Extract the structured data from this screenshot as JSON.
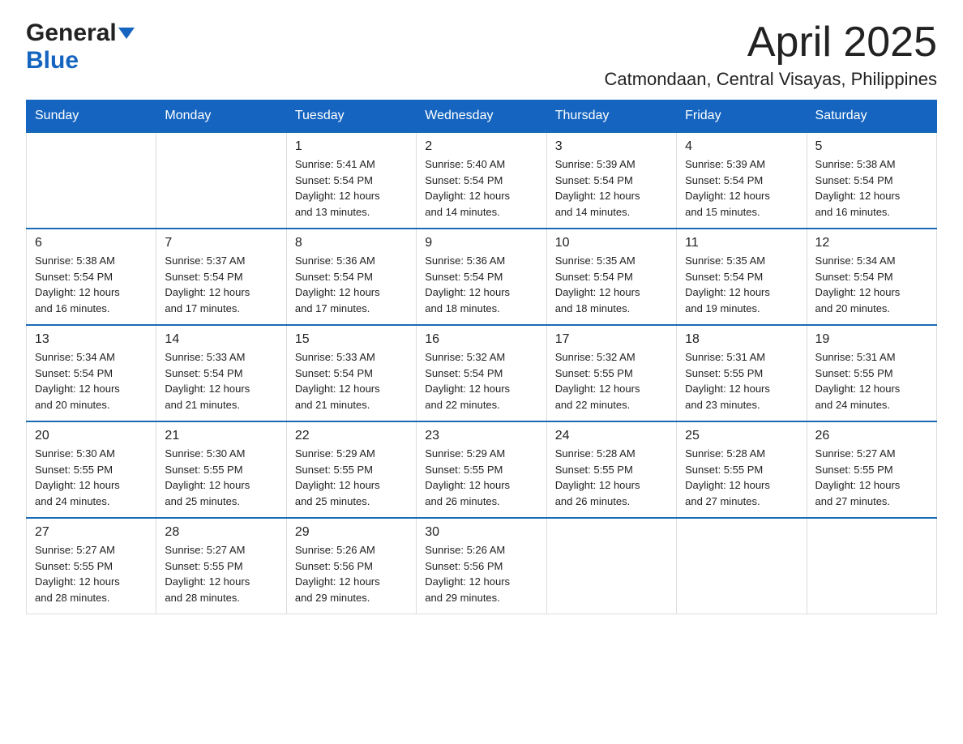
{
  "header": {
    "logo_general": "General",
    "logo_blue": "Blue",
    "title": "April 2025",
    "subtitle": "Catmondaan, Central Visayas, Philippines"
  },
  "weekdays": [
    "Sunday",
    "Monday",
    "Tuesday",
    "Wednesday",
    "Thursday",
    "Friday",
    "Saturday"
  ],
  "weeks": [
    [
      {
        "day": "",
        "info": ""
      },
      {
        "day": "",
        "info": ""
      },
      {
        "day": "1",
        "info": "Sunrise: 5:41 AM\nSunset: 5:54 PM\nDaylight: 12 hours\nand 13 minutes."
      },
      {
        "day": "2",
        "info": "Sunrise: 5:40 AM\nSunset: 5:54 PM\nDaylight: 12 hours\nand 14 minutes."
      },
      {
        "day": "3",
        "info": "Sunrise: 5:39 AM\nSunset: 5:54 PM\nDaylight: 12 hours\nand 14 minutes."
      },
      {
        "day": "4",
        "info": "Sunrise: 5:39 AM\nSunset: 5:54 PM\nDaylight: 12 hours\nand 15 minutes."
      },
      {
        "day": "5",
        "info": "Sunrise: 5:38 AM\nSunset: 5:54 PM\nDaylight: 12 hours\nand 16 minutes."
      }
    ],
    [
      {
        "day": "6",
        "info": "Sunrise: 5:38 AM\nSunset: 5:54 PM\nDaylight: 12 hours\nand 16 minutes."
      },
      {
        "day": "7",
        "info": "Sunrise: 5:37 AM\nSunset: 5:54 PM\nDaylight: 12 hours\nand 17 minutes."
      },
      {
        "day": "8",
        "info": "Sunrise: 5:36 AM\nSunset: 5:54 PM\nDaylight: 12 hours\nand 17 minutes."
      },
      {
        "day": "9",
        "info": "Sunrise: 5:36 AM\nSunset: 5:54 PM\nDaylight: 12 hours\nand 18 minutes."
      },
      {
        "day": "10",
        "info": "Sunrise: 5:35 AM\nSunset: 5:54 PM\nDaylight: 12 hours\nand 18 minutes."
      },
      {
        "day": "11",
        "info": "Sunrise: 5:35 AM\nSunset: 5:54 PM\nDaylight: 12 hours\nand 19 minutes."
      },
      {
        "day": "12",
        "info": "Sunrise: 5:34 AM\nSunset: 5:54 PM\nDaylight: 12 hours\nand 20 minutes."
      }
    ],
    [
      {
        "day": "13",
        "info": "Sunrise: 5:34 AM\nSunset: 5:54 PM\nDaylight: 12 hours\nand 20 minutes."
      },
      {
        "day": "14",
        "info": "Sunrise: 5:33 AM\nSunset: 5:54 PM\nDaylight: 12 hours\nand 21 minutes."
      },
      {
        "day": "15",
        "info": "Sunrise: 5:33 AM\nSunset: 5:54 PM\nDaylight: 12 hours\nand 21 minutes."
      },
      {
        "day": "16",
        "info": "Sunrise: 5:32 AM\nSunset: 5:54 PM\nDaylight: 12 hours\nand 22 minutes."
      },
      {
        "day": "17",
        "info": "Sunrise: 5:32 AM\nSunset: 5:55 PM\nDaylight: 12 hours\nand 22 minutes."
      },
      {
        "day": "18",
        "info": "Sunrise: 5:31 AM\nSunset: 5:55 PM\nDaylight: 12 hours\nand 23 minutes."
      },
      {
        "day": "19",
        "info": "Sunrise: 5:31 AM\nSunset: 5:55 PM\nDaylight: 12 hours\nand 24 minutes."
      }
    ],
    [
      {
        "day": "20",
        "info": "Sunrise: 5:30 AM\nSunset: 5:55 PM\nDaylight: 12 hours\nand 24 minutes."
      },
      {
        "day": "21",
        "info": "Sunrise: 5:30 AM\nSunset: 5:55 PM\nDaylight: 12 hours\nand 25 minutes."
      },
      {
        "day": "22",
        "info": "Sunrise: 5:29 AM\nSunset: 5:55 PM\nDaylight: 12 hours\nand 25 minutes."
      },
      {
        "day": "23",
        "info": "Sunrise: 5:29 AM\nSunset: 5:55 PM\nDaylight: 12 hours\nand 26 minutes."
      },
      {
        "day": "24",
        "info": "Sunrise: 5:28 AM\nSunset: 5:55 PM\nDaylight: 12 hours\nand 26 minutes."
      },
      {
        "day": "25",
        "info": "Sunrise: 5:28 AM\nSunset: 5:55 PM\nDaylight: 12 hours\nand 27 minutes."
      },
      {
        "day": "26",
        "info": "Sunrise: 5:27 AM\nSunset: 5:55 PM\nDaylight: 12 hours\nand 27 minutes."
      }
    ],
    [
      {
        "day": "27",
        "info": "Sunrise: 5:27 AM\nSunset: 5:55 PM\nDaylight: 12 hours\nand 28 minutes."
      },
      {
        "day": "28",
        "info": "Sunrise: 5:27 AM\nSunset: 5:55 PM\nDaylight: 12 hours\nand 28 minutes."
      },
      {
        "day": "29",
        "info": "Sunrise: 5:26 AM\nSunset: 5:56 PM\nDaylight: 12 hours\nand 29 minutes."
      },
      {
        "day": "30",
        "info": "Sunrise: 5:26 AM\nSunset: 5:56 PM\nDaylight: 12 hours\nand 29 minutes."
      },
      {
        "day": "",
        "info": ""
      },
      {
        "day": "",
        "info": ""
      },
      {
        "day": "",
        "info": ""
      }
    ]
  ]
}
